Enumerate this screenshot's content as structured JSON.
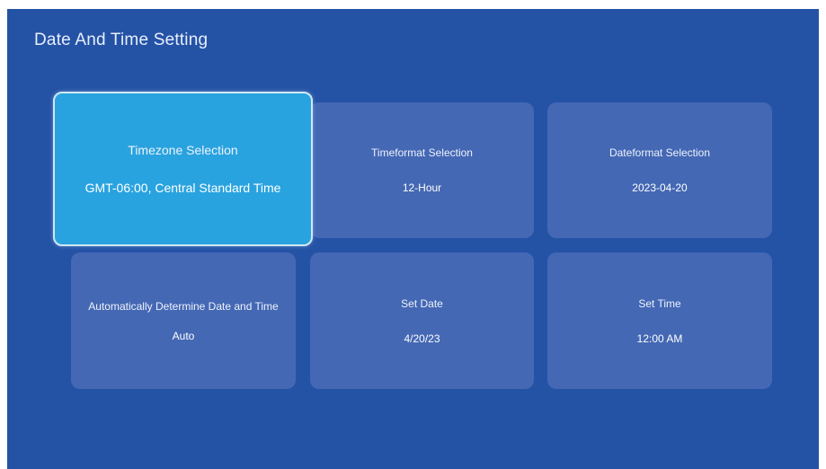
{
  "page": {
    "title": "Date And Time Setting"
  },
  "tiles": {
    "timezone": {
      "label": "Timezone Selection",
      "value": "GMT-06:00, Central Standard Time"
    },
    "timeformat": {
      "label": "Timeformat Selection",
      "value": "12-Hour"
    },
    "dateformat": {
      "label": "Dateformat Selection",
      "value": "2023-04-20"
    },
    "auto": {
      "label": "Automatically Determine Date and Time",
      "value": "Auto"
    },
    "setdate": {
      "label": "Set Date",
      "value": "4/20/23"
    },
    "settime": {
      "label": "Set Time",
      "value": "12:00 AM"
    }
  },
  "colors": {
    "background": "#2453a6",
    "tile": "#4468b4",
    "selected_tile": "#29a3df"
  }
}
